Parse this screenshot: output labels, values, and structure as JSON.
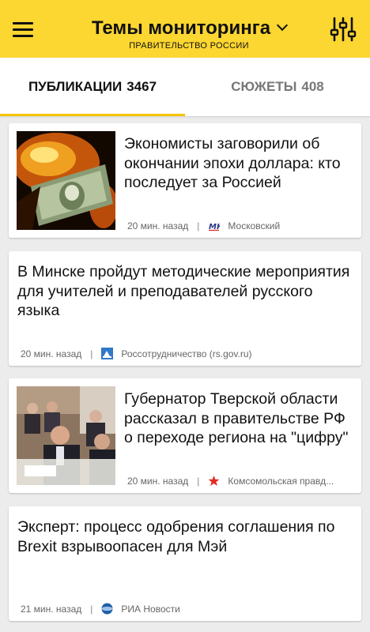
{
  "appbar": {
    "title": "Темы мониторинга",
    "subtitle": "ПРАВИТЕЛЬСТВО РОССИИ",
    "accent": "#fcd631"
  },
  "tabs": [
    {
      "label": "ПУБЛИКАЦИИ",
      "count": "3467",
      "active": true
    },
    {
      "label": "СЮЖЕТЫ",
      "count": "408",
      "active": false
    }
  ],
  "news": [
    {
      "title": "Экономисты заговорили об окончании эпохи доллара: кто последует за Россией",
      "time": "20 мин. назад",
      "source": "Московский",
      "source_icon": "mk-logo-icon",
      "thumb": "burning-dollar-image"
    },
    {
      "title": "В Минске пройдут методические мероприятия для учителей и преподавателей русского языка",
      "time": "20 мин. назад",
      "source": "Россотрудничество (rs.gov.ru)",
      "source_icon": "rossotrudnichestvo-logo-icon"
    },
    {
      "title": "Губернатор Тверской области рассказал в правительстве РФ о переходе региона на \"цифру\"",
      "time": "20 мин. назад",
      "source": "Комсомольская правд...",
      "source_icon": "kp-logo-icon",
      "thumb": "government-meeting-image"
    },
    {
      "title": "Эксперт: процесс одобрения соглашения по Brexit взрывоопасен для Мэй",
      "time": "21 мин. назад",
      "source": "РИА Новости",
      "source_icon": "ria-logo-icon"
    }
  ]
}
